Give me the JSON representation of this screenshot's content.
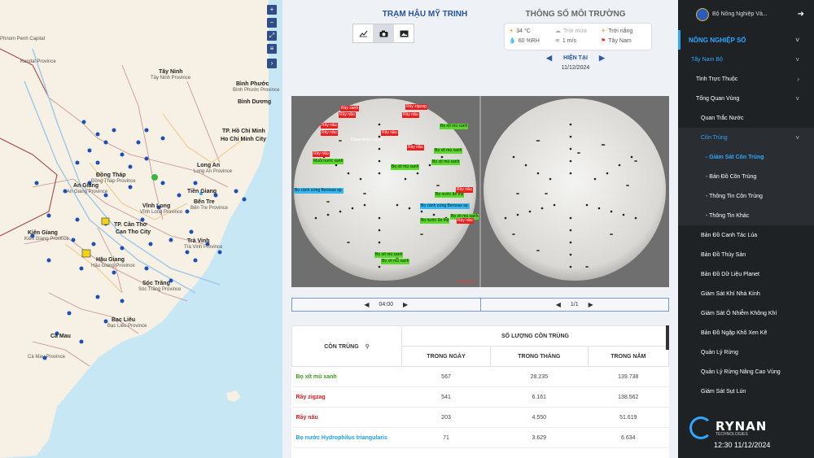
{
  "map": {
    "labels": [
      "Phnom Penh Capital",
      "Kandal Province",
      "Tây Ninh",
      "Tây Ninh Province",
      "Bình Dương",
      "TP. Hồ Chí Minh",
      "Ho Chi Minh City",
      "Long An",
      "Long An Province",
      "Đồng Tháp",
      "Đồng Tháp Province",
      "Tiền Giang",
      "An Giang",
      "An Giang Province",
      "Vĩnh Long",
      "Vĩnh Long Province",
      "Bến Tre",
      "Bến Tre Province",
      "Kiên Giang",
      "Kiên Giang Province",
      "TP. Cần Thơ",
      "Can Tho City",
      "Hậu Giang",
      "Hậu Giang Province",
      "Trà Vinh",
      "Trà Vinh Province",
      "Sóc Trăng",
      "Sóc Trăng Province",
      "Bạc Liêu",
      "Bạc Liêu Province",
      "Cà Mau",
      "Cà Mau Province",
      "Bình Phước",
      "Bình Phước Province"
    ],
    "controls": [
      "+",
      "−",
      "⤢",
      "≡",
      "›"
    ]
  },
  "station": {
    "title": "TRẠM HẬU MỸ TRINH",
    "tabs": [
      "chart-icon",
      "camera-icon",
      "image-icon"
    ]
  },
  "environment": {
    "title": "THÔNG SỐ MÔI TRƯỜNG",
    "temperature": "34 °C",
    "humidity": "60 %RH",
    "rain": "Trời mưa",
    "wind": "1 m/s",
    "sun": "Trời nắng",
    "direction": "Tây Nam",
    "nav_label": "HIỆN TẠI",
    "date": "11/12/2024"
  },
  "photos": {
    "detections_left": [
      {
        "t": "Rầy xanh",
        "c": "r"
      },
      {
        "t": "Rầy zigzag",
        "c": "r"
      },
      {
        "t": "Rầy nâu",
        "c": "r"
      },
      {
        "t": "Rầy nâu",
        "c": "r"
      },
      {
        "t": "Rầy nâu",
        "c": "r"
      },
      {
        "t": "Bọ xít mù xanh",
        "c": "g"
      },
      {
        "t": "Rầy nâu",
        "c": "r"
      },
      {
        "t": "Rầy nâu",
        "c": "r"
      },
      {
        "t": "Diaeretiella rapae",
        "c": "w"
      },
      {
        "t": "Rầy nâu",
        "c": "r"
      },
      {
        "t": "Bọ xít mù xanh",
        "c": "g"
      },
      {
        "t": "Rầy nâu",
        "c": "r"
      },
      {
        "t": "Muỗi nước xanh",
        "c": "g"
      },
      {
        "t": "Bọ xít mù xanh",
        "c": "g"
      },
      {
        "t": "Bọ xít mù xanh",
        "c": "g"
      },
      {
        "t": "Bọ cánh cứng Berosus sp.",
        "c": "b"
      },
      {
        "t": "Bọ nước ăn thịt",
        "c": "g"
      },
      {
        "t": "Rầy nâu",
        "c": "r"
      },
      {
        "t": "Bọ cánh cứng Berosus sp.",
        "c": "b"
      },
      {
        "t": "Bọ xít mù xanh",
        "c": "g"
      },
      {
        "t": "Bọ nước ăn thịt",
        "c": "g"
      },
      {
        "t": "Rầy nâu",
        "c": "r"
      },
      {
        "t": "Bọ xít mù xanh",
        "c": "g"
      },
      {
        "t": "Bọ xít mù xanh",
        "c": "g"
      }
    ],
    "watermark": "RYNAN AI",
    "time": "04:00",
    "page": "1/1"
  },
  "table": {
    "col_insect": "CÔN TRÙNG",
    "col_group": "SỐ LƯỢNG CÔN TRÙNG",
    "col_day": "TRONG NGÀY",
    "col_month": "TRONG THÁNG",
    "col_year": "TRONG NĂM",
    "rows": [
      {
        "name": "Bọ xít mù xanh",
        "day": "567",
        "month": "28.235",
        "year": "139.738",
        "color": "#3e9b1d"
      },
      {
        "name": "Rầy zigzag",
        "day": "541",
        "month": "6.161",
        "year": "138.562",
        "color": "#e31e1e"
      },
      {
        "name": "Rầy nâu",
        "day": "203",
        "month": "4.550",
        "year": "51.619",
        "color": "#e31e1e"
      },
      {
        "name": "Bọ nước Hydrophilus triangularis",
        "day": "71",
        "month": "3.629",
        "year": "6.634",
        "color": "#1e9fe3"
      }
    ]
  },
  "sidebar": {
    "org": "Bộ Nông Nghiệp Và...",
    "items": [
      {
        "label": "NÔNG NGHIỆP SỐ",
        "cls": "sec",
        "indent": 10,
        "chev": "˅"
      },
      {
        "label": "Tây Nam Bộ",
        "cls": "lvl1",
        "indent": 16,
        "chev": "˅"
      },
      {
        "label": "Tỉnh Trực Thuộc",
        "cls": "",
        "indent": 22,
        "chev": "›"
      },
      {
        "label": "Tổng Quan Vùng",
        "cls": "",
        "indent": 22,
        "chev": "˅"
      },
      {
        "label": "Quan Trắc Nước",
        "cls": "",
        "indent": 28,
        "chev": ""
      },
      {
        "label": "Côn Trùng",
        "cls": "blue lvl3",
        "indent": 28,
        "chev": "˅"
      },
      {
        "label": "- Giám Sát Côn Trùng",
        "cls": "active",
        "indent": 34,
        "chev": ""
      },
      {
        "label": "- Bản Đồ Côn Trùng",
        "cls": "lvl3",
        "indent": 34,
        "chev": ""
      },
      {
        "label": "- Thông Tin Côn Trùng",
        "cls": "lvl3",
        "indent": 34,
        "chev": ""
      },
      {
        "label": "- Thông Tin Khác",
        "cls": "lvl3",
        "indent": 34,
        "chev": ""
      },
      {
        "label": "Bản Đồ Canh Tác Lúa",
        "cls": "",
        "indent": 28,
        "chev": ""
      },
      {
        "label": "Bản Đồ Thủy Sản",
        "cls": "",
        "indent": 28,
        "chev": ""
      },
      {
        "label": "Bản Đồ Dữ Liệu Planet",
        "cls": "",
        "indent": 28,
        "chev": ""
      },
      {
        "label": "Giám Sát Khí Nhà Kính",
        "cls": "",
        "indent": 28,
        "chev": ""
      },
      {
        "label": "Giám Sát Ô Nhiễm Không Khí",
        "cls": "",
        "indent": 28,
        "chev": ""
      },
      {
        "label": "Bản Đồ Ngập Khô Xen Kẽ",
        "cls": "",
        "indent": 28,
        "chev": ""
      },
      {
        "label": "Quản Lý Rừng",
        "cls": "",
        "indent": 28,
        "chev": ""
      },
      {
        "label": "Quản Lý Rừng Nâng Cao Vùng",
        "cls": "",
        "indent": 28,
        "chev": ""
      },
      {
        "label": "Giám Sát Sụt Lún",
        "cls": "",
        "indent": 28,
        "chev": ""
      }
    ],
    "brand": "RYNAN",
    "brand_sub": "TECHNOLOGIES",
    "clock": "12:30 11/12/2024"
  }
}
